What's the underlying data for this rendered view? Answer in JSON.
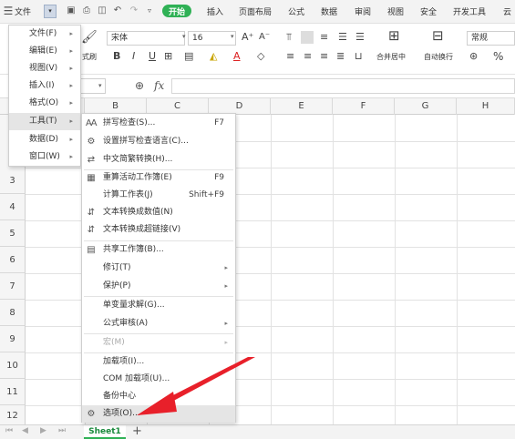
{
  "tabbar": {
    "file_label": "文件",
    "start_label": "开始",
    "tabs": [
      "插入",
      "页面布局",
      "公式",
      "数据",
      "审阅",
      "视图",
      "安全",
      "开发工具",
      "云"
    ]
  },
  "ribbon": {
    "font_name": "宋体",
    "font_size": "16",
    "format_brush_label": "式刷",
    "merge_label": "合并居中",
    "wrap_label": "自动换行",
    "number_format": "常规",
    "percent": "%"
  },
  "formula_bar": {
    "fx_label": "fx"
  },
  "grid": {
    "columns": [
      "B",
      "C",
      "D",
      "E",
      "F",
      "G",
      "H"
    ],
    "rows": [
      "3",
      "4",
      "5",
      "6",
      "7",
      "8",
      "9",
      "10",
      "11",
      "12"
    ]
  },
  "sheetbar": {
    "sheet_name": "Sheet1",
    "add_label": "+"
  },
  "main_menu": {
    "items": [
      {
        "label": "文件(F)"
      },
      {
        "label": "编辑(E)"
      },
      {
        "label": "视图(V)"
      },
      {
        "label": "插入(I)"
      },
      {
        "label": "格式(O)"
      },
      {
        "label": "工具(T)"
      },
      {
        "label": "数据(D)"
      },
      {
        "label": "窗口(W)"
      }
    ]
  },
  "tools_menu": {
    "items": [
      {
        "label": "拼写检查(S)...",
        "shortcut": "F7",
        "icon": "spellcheck-icon"
      },
      {
        "label": "设置拼写检查语言(C)...",
        "shortcut": "",
        "icon": "language-icon"
      },
      {
        "label": "中文简繁转换(H)...",
        "shortcut": "",
        "icon": "convert-icon"
      },
      {
        "label": "重算活动工作簿(E)",
        "shortcut": "F9",
        "icon": "recalc-icon"
      },
      {
        "label": "计算工作表(J)",
        "shortcut": "Shift+F9",
        "icon": ""
      },
      {
        "label": "文本转换成数值(N)",
        "shortcut": "",
        "icon": "text-to-number-icon"
      },
      {
        "label": "文本转换成超链接(V)",
        "shortcut": "",
        "icon": "text-to-link-icon"
      },
      {
        "label": "共享工作簿(B)...",
        "shortcut": "",
        "icon": "share-icon"
      },
      {
        "label": "修订(T)",
        "shortcut": "",
        "icon": ""
      },
      {
        "label": "保护(P)",
        "shortcut": "",
        "icon": ""
      },
      {
        "label": "单变量求解(G)...",
        "shortcut": "",
        "icon": ""
      },
      {
        "label": "公式审核(A)",
        "shortcut": "",
        "icon": ""
      },
      {
        "label": "宏(M)",
        "shortcut": "",
        "icon": ""
      },
      {
        "label": "加载项(I)...",
        "shortcut": "",
        "icon": ""
      },
      {
        "label": "COM 加载项(U)...",
        "shortcut": "",
        "icon": ""
      },
      {
        "label": "备份中心",
        "shortcut": "",
        "icon": ""
      },
      {
        "label": "选项(O)...",
        "shortcut": "",
        "icon": "gear-icon"
      }
    ]
  },
  "colors": {
    "start_tab": "#2fb155",
    "arrow": "#e8202a",
    "highlight": "#e5e5e5"
  }
}
